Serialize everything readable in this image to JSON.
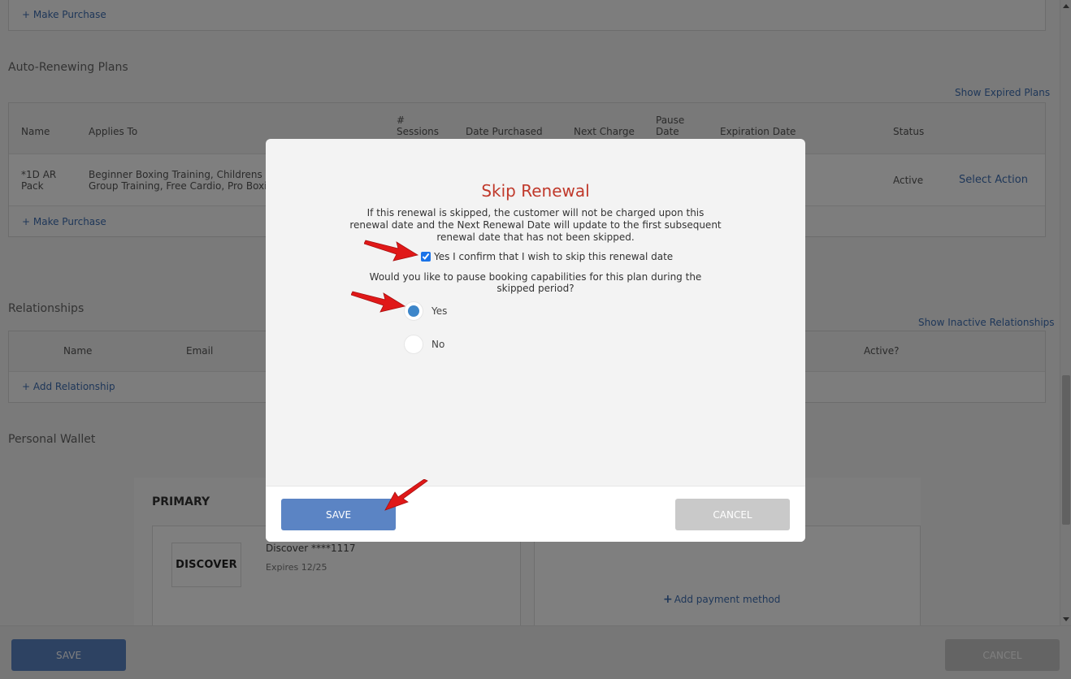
{
  "sections": {
    "auto_renewing_title": "Auto-Renewing Plans",
    "relationships_title": "Relationships",
    "personal_wallet_title": "Personal Wallet"
  },
  "links": {
    "make_purchase_top": "+ Make Purchase",
    "show_expired_plans": "Show Expired Plans",
    "make_purchase_plans": "+ Make Purchase",
    "show_inactive_relationships": "Show Inactive Relationships",
    "add_relationship": "+ Add Relationship",
    "add_payment_method": "Add payment method"
  },
  "plans_table": {
    "headers": {
      "name": "Name",
      "applies_to": "Applies To",
      "sessions_1": "#",
      "sessions_2": "Sessions",
      "date_purchased": "Date Purchased",
      "next_charge": "Next Charge",
      "pause_date_1": "Pause",
      "pause_date_2": "Date",
      "expiration_date": "Expiration Date",
      "status": "Status"
    },
    "row": {
      "name_1": "*1D AR",
      "name_2": "Pack",
      "applies_1": "Beginner Boxing Training, Childrens Fitn",
      "applies_2": "Group Training, Free Cardio, Pro Boxing",
      "status": "Active",
      "action": "Select Action"
    }
  },
  "relationships_table": {
    "headers": {
      "name": "Name",
      "email": "Email",
      "active": "Active?"
    }
  },
  "wallet": {
    "primary_label": "PRIMARY",
    "card_logo": "DISCOVER",
    "card_name": "Discover ****1117",
    "card_expiry": "Expires 12/25"
  },
  "footer": {
    "save": "SAVE",
    "cancel": "CANCEL"
  },
  "modal": {
    "title": "Skip Renewal",
    "description": "If this renewal is skipped, the customer will not be charged upon this renewal date and the Next Renewal Date will update to the first subsequent renewal date that has not been skipped.",
    "confirm_label": "Yes I confirm that I wish to skip this renewal date",
    "confirm_checked": true,
    "pause_question": "Would you like to pause booking capabilities for this plan during the skipped period?",
    "options": [
      {
        "label": "Yes",
        "selected": true
      },
      {
        "label": "No",
        "selected": false
      }
    ],
    "save": "SAVE",
    "cancel": "CANCEL"
  },
  "colors": {
    "accent_blue": "#5b84c4",
    "title_red": "#c0392b",
    "link_blue": "#3e6fb3",
    "annotation_red": "#e01818"
  },
  "icons": {
    "arrow": "red-annotation-arrow",
    "plus": "plus-icon"
  }
}
